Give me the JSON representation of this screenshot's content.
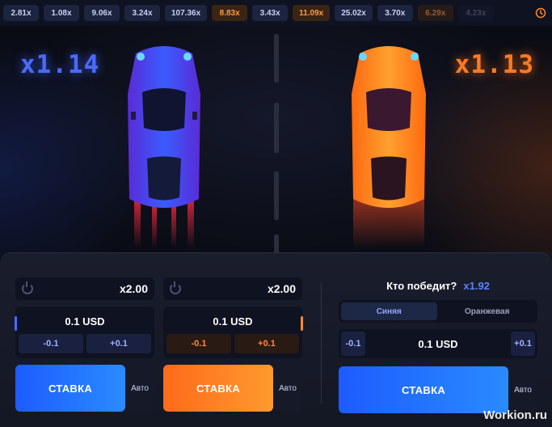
{
  "history": {
    "chips": [
      {
        "label": "2.81x",
        "tone": "blue"
      },
      {
        "label": "1.08x",
        "tone": "blue"
      },
      {
        "label": "9.06x",
        "tone": "blue"
      },
      {
        "label": "3.24x",
        "tone": "blue"
      },
      {
        "label": "107.36x",
        "tone": "blue"
      },
      {
        "label": "8.83x",
        "tone": "orange"
      },
      {
        "label": "3.43x",
        "tone": "blue"
      },
      {
        "label": "11.09x",
        "tone": "orange"
      },
      {
        "label": "25.02x",
        "tone": "blue"
      },
      {
        "label": "3.70x",
        "tone": "blue"
      },
      {
        "label": "6.29x",
        "tone": "orange"
      },
      {
        "label": "4.23x",
        "tone": "blue"
      }
    ],
    "history_icon": "clock-icon"
  },
  "race": {
    "blue_multiplier": "x1.14",
    "orange_multiplier": "x1.13",
    "blue_color": "#4a6bff",
    "orange_color": "#ff7a22"
  },
  "bet_blue": {
    "odds": "x2.00",
    "amount": "0.1 USD",
    "minus": "-0.1",
    "plus": "+0.1",
    "action": "СТАВКА",
    "auto": "Авто"
  },
  "bet_orange": {
    "odds": "x2.00",
    "amount": "0.1 USD",
    "minus": "-0.1",
    "plus": "+0.1",
    "action": "СТАВКА",
    "auto": "Авто"
  },
  "who_wins": {
    "title": "Кто победит?",
    "odds": "x1.92",
    "options": [
      "Синяя",
      "Оранжевая"
    ],
    "selected": "Синяя",
    "minus": "-0.1",
    "amount": "0.1 USD",
    "plus": "+0.1",
    "action": "СТАВКА",
    "auto": "Авто"
  },
  "watermark": "Workion.ru"
}
